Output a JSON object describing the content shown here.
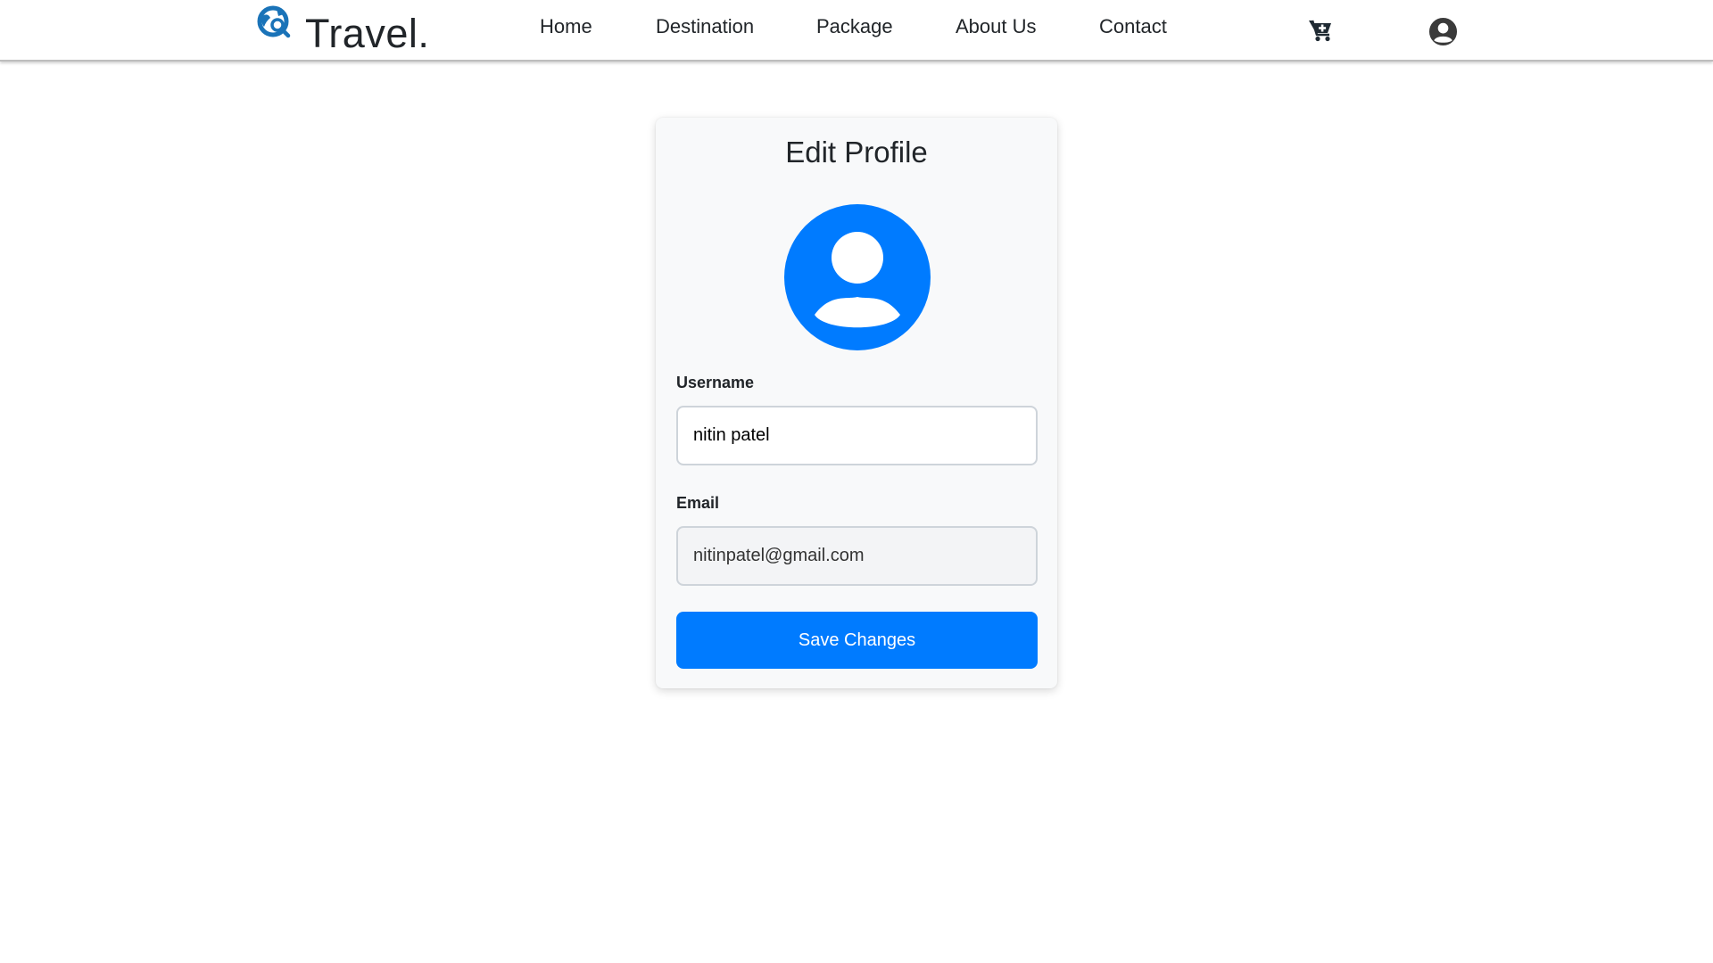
{
  "header": {
    "brand": "Travel.",
    "brand_icon": "globe-search-icon",
    "nav": [
      "Home",
      "Destination",
      "Package",
      "About Us",
      "Contact"
    ],
    "cart_icon": "cart-plus-icon",
    "account_icon": "user-circle-icon"
  },
  "profile": {
    "title": "Edit Profile",
    "avatar_icon": "user-avatar-icon",
    "username_label": "Username",
    "username_value": "nitin patel",
    "email_label": "Email",
    "email_value": "nitinpatel@gmail.com",
    "save_label": "Save Changes"
  },
  "colors": {
    "accent": "#007bff",
    "brand_icon": "#1a73b8",
    "card_bg": "#f8f9fa"
  }
}
